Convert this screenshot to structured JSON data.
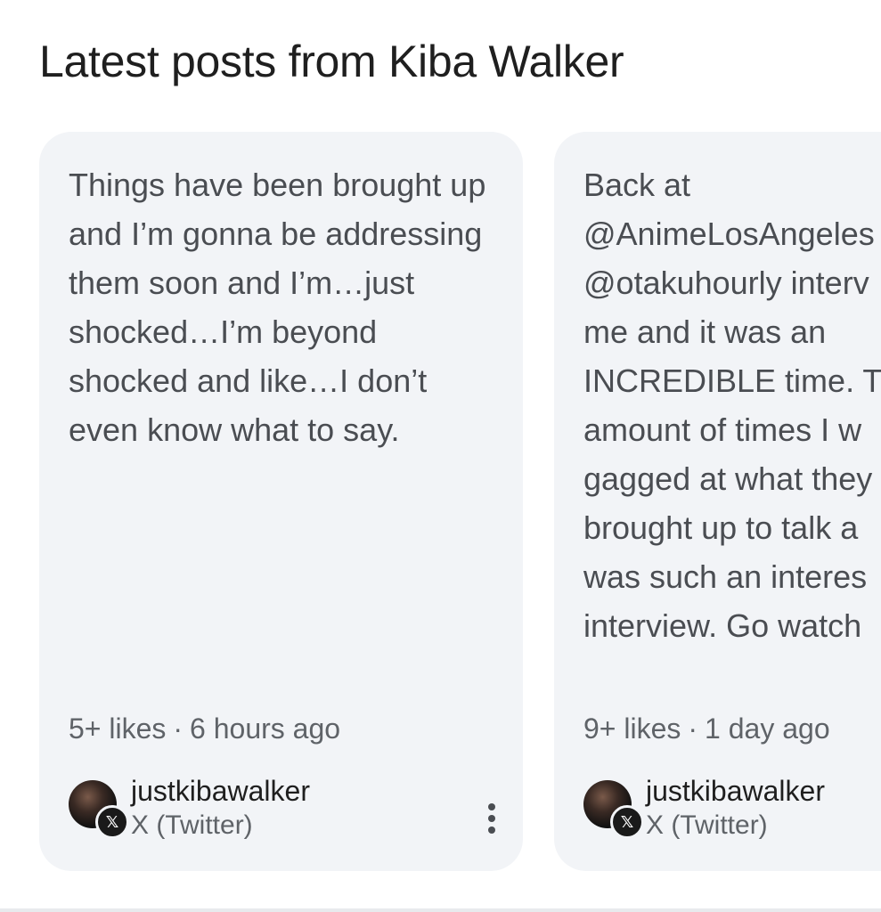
{
  "section": {
    "title": "Latest posts from Kiba Walker"
  },
  "posts": [
    {
      "text": "Things have been brought up and I’m gonna be addressing them soon and I’m…just shocked…I’m beyond shocked and like…I don’t even know what to say.",
      "likes": "5+ likes",
      "separator": "·",
      "time": "6 hours ago",
      "author": "justkibawalker",
      "source": "X (Twitter)",
      "badge_icon": "x-logo-icon",
      "badge_glyph": "𝕏"
    },
    {
      "text_lines": [
        "Back at",
        "@AnimeLosAngeles",
        "@otakuhourly interv",
        "me and it was an",
        "INCREDIBLE time. T",
        "amount of times I w",
        "gagged at what they",
        "brought up to talk a",
        "was such an interes",
        "interview. Go watch"
      ],
      "likes": "9+ likes",
      "separator": "·",
      "time": "1 day ago",
      "author": "justkibawalker",
      "source": "X (Twitter)",
      "badge_icon": "x-logo-icon",
      "badge_glyph": "𝕏"
    }
  ],
  "colors": {
    "card_background": "#f2f4f7",
    "title_text": "#1f1f1f",
    "body_text": "#4a4d52",
    "meta_text": "#5f6368"
  }
}
